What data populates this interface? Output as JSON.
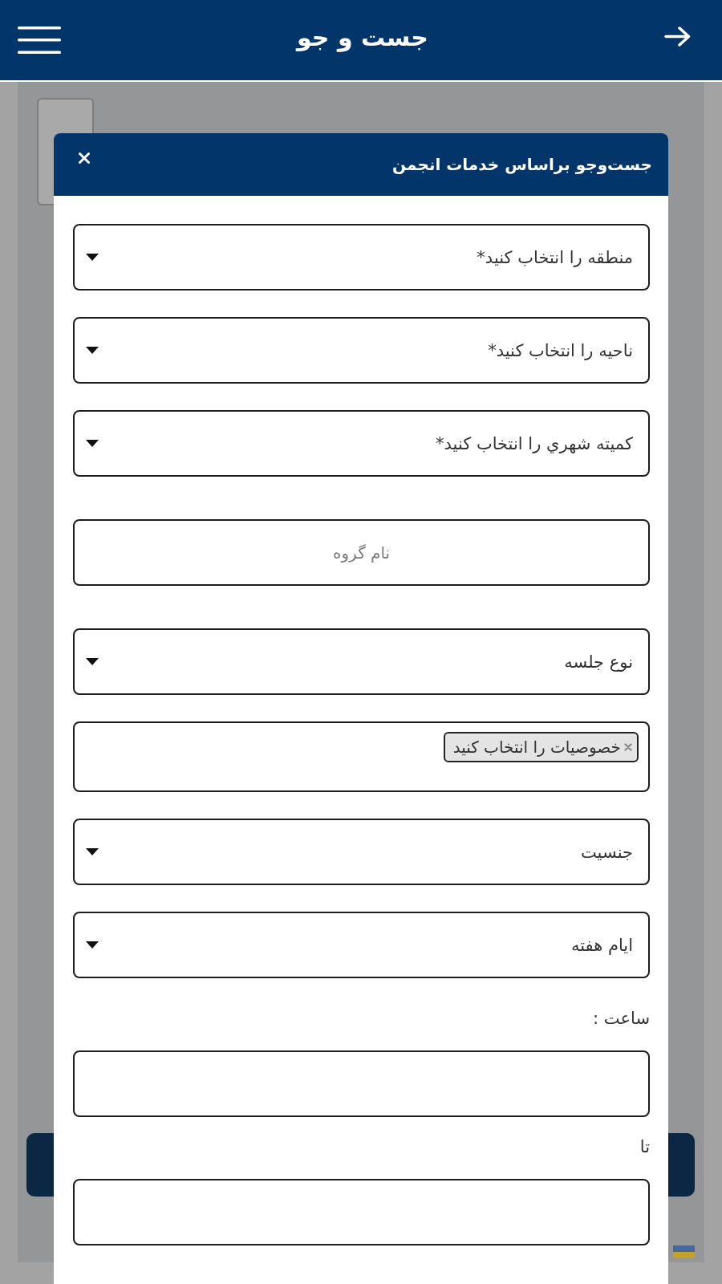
{
  "header": {
    "title": "جست و جو"
  },
  "dialog": {
    "title": "جست‌وجو براساس خدمات انجمن",
    "fields": [
      {
        "kind": "select",
        "value": "منطقه را انتخاب کنید*"
      },
      {
        "kind": "select",
        "value": "ناحیه را انتخاب کنید*"
      },
      {
        "kind": "select",
        "value": "کمیته شهري را انتخاب کنید*"
      },
      {
        "kind": "text",
        "placeholder": "نام گروه"
      },
      {
        "kind": "select",
        "value": "نوع جلسه"
      },
      {
        "kind": "tags",
        "tags": [
          {
            "label": "خصوصیات را انتخاب کنید"
          }
        ]
      },
      {
        "kind": "select",
        "value": "جنسیت"
      },
      {
        "kind": "select",
        "value": "ایام هفته"
      },
      {
        "kind": "text",
        "label": "ساعت :"
      },
      {
        "kind": "text",
        "label": "تا"
      }
    ]
  }
}
